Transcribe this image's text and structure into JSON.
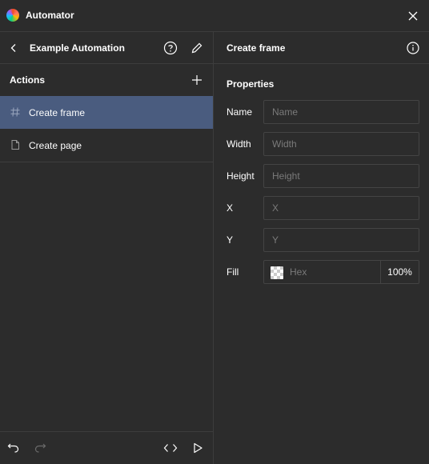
{
  "app": {
    "title": "Automator"
  },
  "left": {
    "automation_name": "Example Automation",
    "actions_label": "Actions",
    "actions": [
      {
        "label": "Create frame",
        "icon": "hash-icon",
        "selected": true
      },
      {
        "label": "Create page",
        "icon": "page-icon",
        "selected": false
      }
    ]
  },
  "right": {
    "title": "Create frame",
    "properties_label": "Properties",
    "fields": [
      {
        "label": "Name",
        "placeholder": "Name"
      },
      {
        "label": "Width",
        "placeholder": "Width"
      },
      {
        "label": "Height",
        "placeholder": "Height"
      },
      {
        "label": "X",
        "placeholder": "X"
      },
      {
        "label": "Y",
        "placeholder": "Y"
      }
    ],
    "fill": {
      "label": "Fill",
      "placeholder": "Hex",
      "opacity": "100%"
    }
  },
  "colors": {
    "background": "#2c2c2c",
    "selected": "#4a5c7f",
    "border": "#3d3d3d",
    "placeholder": "#7a7a7a"
  }
}
